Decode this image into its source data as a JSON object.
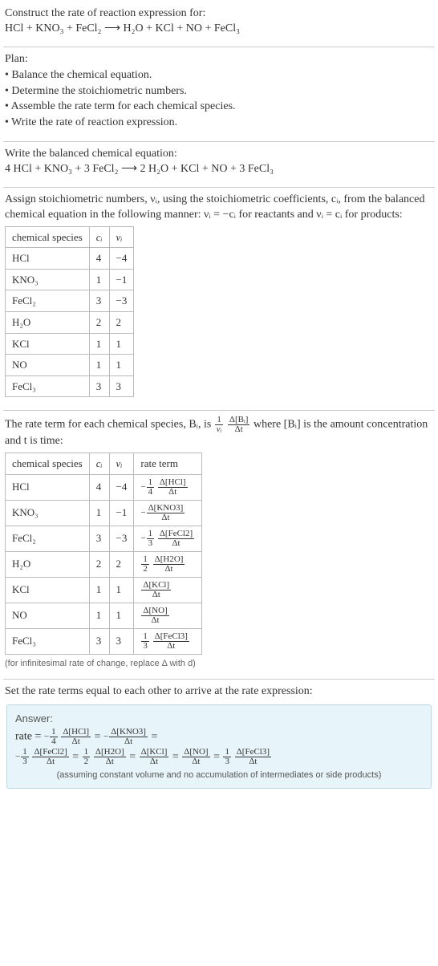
{
  "intro": {
    "title": "Construct the rate of reaction expression for:",
    "equation": "HCl + KNO₃ + FeCl₂  ⟶  H₂O + KCl + NO + FeCl₃"
  },
  "plan": {
    "heading": "Plan:",
    "items": [
      "Balance the chemical equation.",
      "Determine the stoichiometric numbers.",
      "Assemble the rate term for each chemical species.",
      "Write the rate of reaction expression."
    ]
  },
  "balanced": {
    "heading": "Write the balanced chemical equation:",
    "equation": "4 HCl + KNO₃ + 3 FeCl₂  ⟶  2 H₂O + KCl + NO + 3 FeCl₃"
  },
  "stoich": {
    "para_a": "Assign stoichiometric numbers, νᵢ, using the stoichiometric coefficients, cᵢ, from the balanced chemical equation in the following manner: νᵢ = −cᵢ for reactants and νᵢ = cᵢ for products:",
    "headers": {
      "species": "chemical species",
      "ci": "cᵢ",
      "vi": "νᵢ"
    },
    "rows": [
      {
        "species": "HCl",
        "ci": "4",
        "vi": "−4"
      },
      {
        "species": "KNO₃",
        "ci": "1",
        "vi": "−1"
      },
      {
        "species": "FeCl₂",
        "ci": "3",
        "vi": "−3"
      },
      {
        "species": "H₂O",
        "ci": "2",
        "vi": "2"
      },
      {
        "species": "KCl",
        "ci": "1",
        "vi": "1"
      },
      {
        "species": "NO",
        "ci": "1",
        "vi": "1"
      },
      {
        "species": "FeCl₃",
        "ci": "3",
        "vi": "3"
      }
    ]
  },
  "rate_terms": {
    "para_before": "The rate term for each chemical species, Bᵢ, is ",
    "para_after": " where [Bᵢ] is the amount concentration and t is time:",
    "frac_outer_num": "1",
    "frac_outer_den": "νᵢ",
    "frac_inner_num": "Δ[Bᵢ]",
    "frac_inner_den": "Δt",
    "headers": {
      "species": "chemical species",
      "ci": "cᵢ",
      "vi": "νᵢ",
      "rate": "rate term"
    },
    "rows": [
      {
        "species": "HCl",
        "ci": "4",
        "vi": "−4",
        "sign": "−",
        "coef_num": "1",
        "coef_den": "4",
        "d_num": "Δ[HCl]",
        "d_den": "Δt"
      },
      {
        "species": "KNO₃",
        "ci": "1",
        "vi": "−1",
        "sign": "−",
        "coef_num": "",
        "coef_den": "",
        "d_num": "Δ[KNO3]",
        "d_den": "Δt"
      },
      {
        "species": "FeCl₂",
        "ci": "3",
        "vi": "−3",
        "sign": "−",
        "coef_num": "1",
        "coef_den": "3",
        "d_num": "Δ[FeCl2]",
        "d_den": "Δt"
      },
      {
        "species": "H₂O",
        "ci": "2",
        "vi": "2",
        "sign": "",
        "coef_num": "1",
        "coef_den": "2",
        "d_num": "Δ[H2O]",
        "d_den": "Δt"
      },
      {
        "species": "KCl",
        "ci": "1",
        "vi": "1",
        "sign": "",
        "coef_num": "",
        "coef_den": "",
        "d_num": "Δ[KCl]",
        "d_den": "Δt"
      },
      {
        "species": "NO",
        "ci": "1",
        "vi": "1",
        "sign": "",
        "coef_num": "",
        "coef_den": "",
        "d_num": "Δ[NO]",
        "d_den": "Δt"
      },
      {
        "species": "FeCl₃",
        "ci": "3",
        "vi": "3",
        "sign": "",
        "coef_num": "1",
        "coef_den": "3",
        "d_num": "Δ[FeCl3]",
        "d_den": "Δt"
      }
    ],
    "note": "(for infinitesimal rate of change, replace Δ with d)"
  },
  "final": {
    "heading": "Set the rate terms equal to each other to arrive at the rate expression:",
    "answer_label": "Answer:",
    "rate_word": "rate = ",
    "eq_sep": " = ",
    "terms": [
      {
        "sign": "−",
        "coef_num": "1",
        "coef_den": "4",
        "d_num": "Δ[HCl]",
        "d_den": "Δt"
      },
      {
        "sign": "−",
        "coef_num": "",
        "coef_den": "",
        "d_num": "Δ[KNO3]",
        "d_den": "Δt"
      },
      {
        "sign": "−",
        "coef_num": "1",
        "coef_den": "3",
        "d_num": "Δ[FeCl2]",
        "d_den": "Δt"
      },
      {
        "sign": "",
        "coef_num": "1",
        "coef_den": "2",
        "d_num": "Δ[H2O]",
        "d_den": "Δt"
      },
      {
        "sign": "",
        "coef_num": "",
        "coef_den": "",
        "d_num": "Δ[KCl]",
        "d_den": "Δt"
      },
      {
        "sign": "",
        "coef_num": "",
        "coef_den": "",
        "d_num": "Δ[NO]",
        "d_den": "Δt"
      },
      {
        "sign": "",
        "coef_num": "1",
        "coef_den": "3",
        "d_num": "Δ[FeCl3]",
        "d_den": "Δt"
      }
    ],
    "note": "(assuming constant volume and no accumulation of intermediates or side products)"
  }
}
